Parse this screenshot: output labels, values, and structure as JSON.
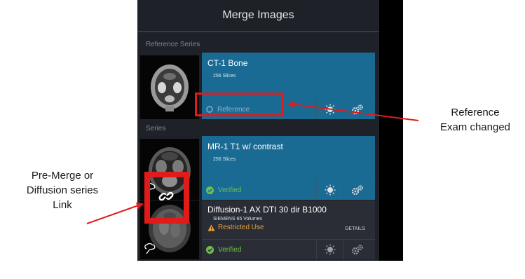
{
  "panel": {
    "title": "Merge Images",
    "reference_label": "Reference Series",
    "series_label": "Series"
  },
  "reference_series": {
    "name": "CT-1 Bone",
    "slices": "256 Slices",
    "status": "Reference"
  },
  "series": [
    {
      "name": "MR-1 T1 w/ contrast",
      "slices": "256 Slices",
      "status": "Verified"
    },
    {
      "name": "Diffusion-1 AX DTI 30 dir B1000",
      "slices": "SIEMENS 65 Volumes",
      "warning": "Restricted Use",
      "details_label": "DETAILS",
      "status": "Verified"
    }
  ],
  "annotations": {
    "reference_line1": "Reference",
    "reference_line2": "Exam changed",
    "link_line1": "Pre-Merge or",
    "link_line2": "Diffusion series",
    "link_line3": "Link"
  },
  "colors": {
    "panel_bg": "#1f2128",
    "selected_row": "#1a6b94",
    "verified_green": "#6cc04a",
    "warning_orange": "#e8a13a",
    "highlight_red": "#e11a1a"
  },
  "icons": [
    "contrast-icon",
    "gear-icon",
    "link-icon",
    "check-icon",
    "warning-icon",
    "brain-icon"
  ]
}
